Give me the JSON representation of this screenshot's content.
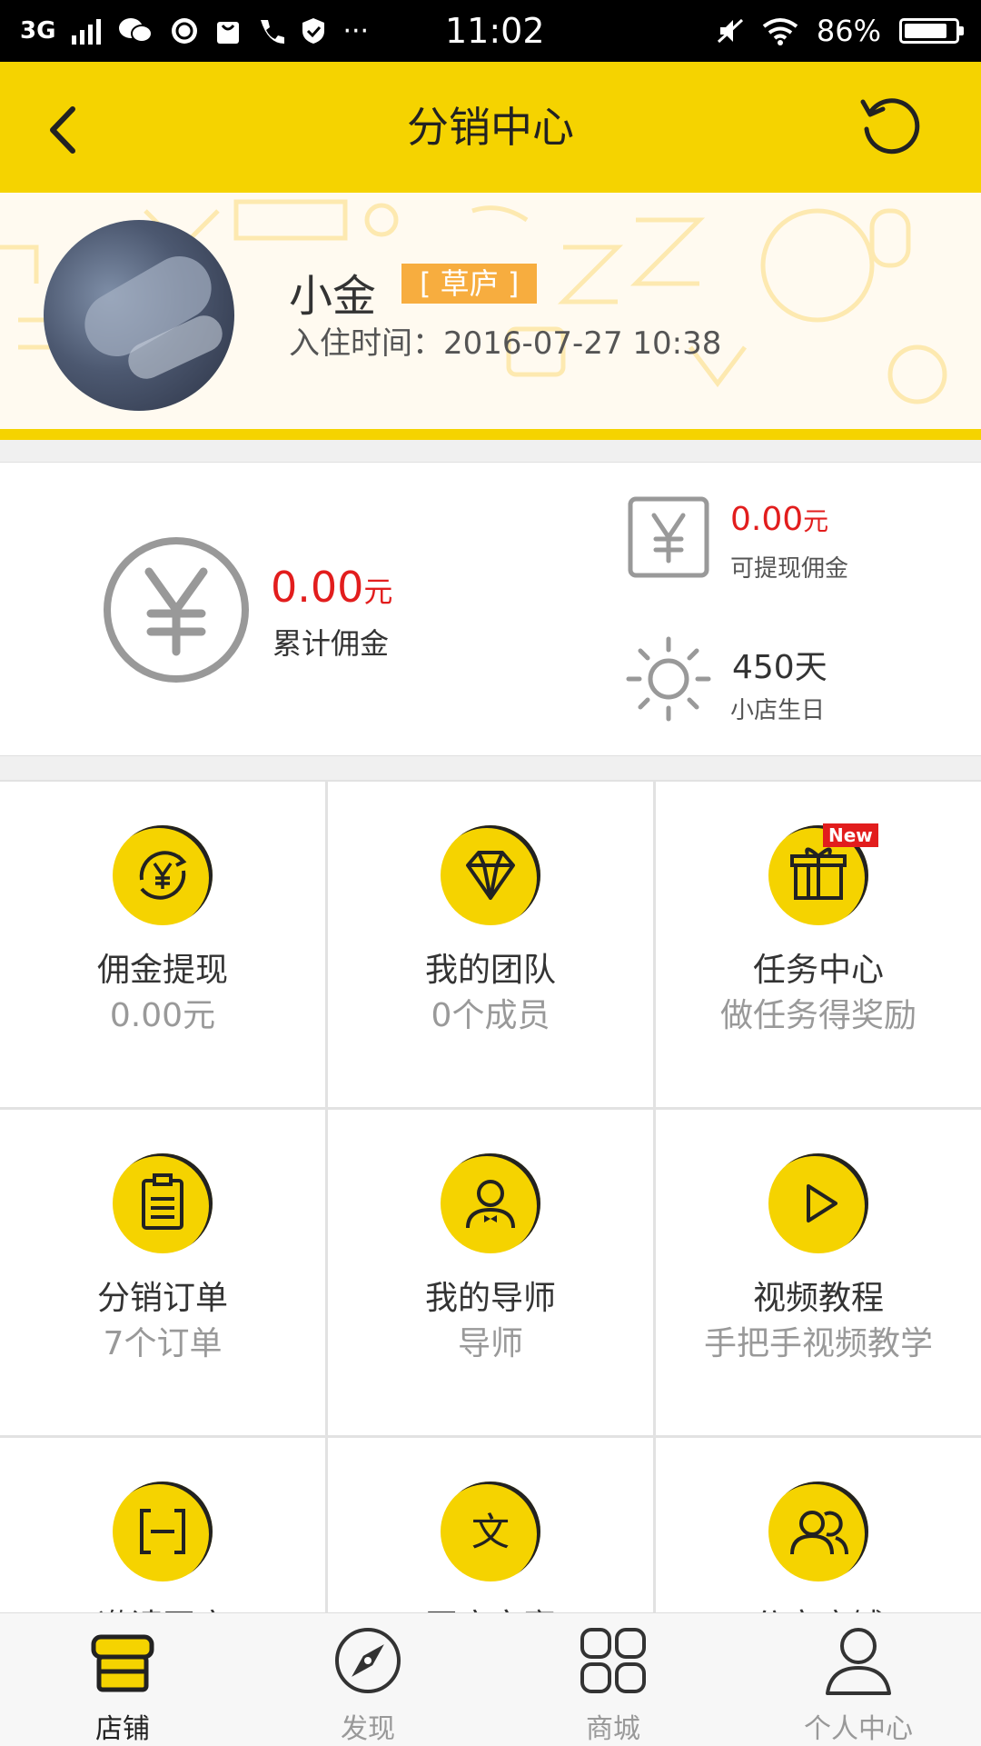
{
  "status_bar": {
    "network": "3G",
    "time": "11:02",
    "battery": "86%",
    "more": "···"
  },
  "header": {
    "title": "分销中心",
    "back_icon": "chevron-left-icon",
    "refresh_icon": "refresh-icon",
    "background_color": "#f5d300"
  },
  "profile": {
    "name": "小金",
    "badge": "[ 草庐 ]",
    "join_time": "入住时间：2016-07-27 10:38"
  },
  "stats": {
    "total": {
      "value": "0.00",
      "unit": "元",
      "label": "累计佣金"
    },
    "withdrawable": {
      "value": "0.00",
      "unit": "元",
      "label": "可提现佣金"
    },
    "birthday": {
      "value": "450天",
      "label": "小店生日"
    },
    "accent_color": "#e21d1d"
  },
  "grid": {
    "items": [
      {
        "icon": "yen-exchange-icon",
        "label": "佣金提现",
        "sub": "0.00元"
      },
      {
        "icon": "diamond-icon",
        "label": "我的团队",
        "sub": "0个成员"
      },
      {
        "icon": "gift-icon",
        "label": "任务中心",
        "sub": "做任务得奖励",
        "tag": "New"
      },
      {
        "icon": "clipboard-icon",
        "label": "分销订单",
        "sub": "7个订单"
      },
      {
        "icon": "mentor-icon",
        "label": "我的导师",
        "sub": "导师"
      },
      {
        "icon": "play-icon",
        "label": "视频教程",
        "sub": "手把手视频教学"
      },
      {
        "icon": "scan-icon",
        "label": "邀请开店",
        "sub": ""
      },
      {
        "icon": "text-icon",
        "label": "开店文案",
        "sub": ""
      },
      {
        "icon": "users-icon",
        "label": "分享店铺",
        "sub": ""
      }
    ]
  },
  "tabbar": {
    "tabs": [
      {
        "label": "店铺",
        "icon": "shop-icon",
        "active": true
      },
      {
        "label": "发现",
        "icon": "compass-icon",
        "active": false
      },
      {
        "label": "商城",
        "icon": "grid-icon",
        "active": false
      },
      {
        "label": "个人中心",
        "icon": "person-icon",
        "active": false
      }
    ]
  }
}
